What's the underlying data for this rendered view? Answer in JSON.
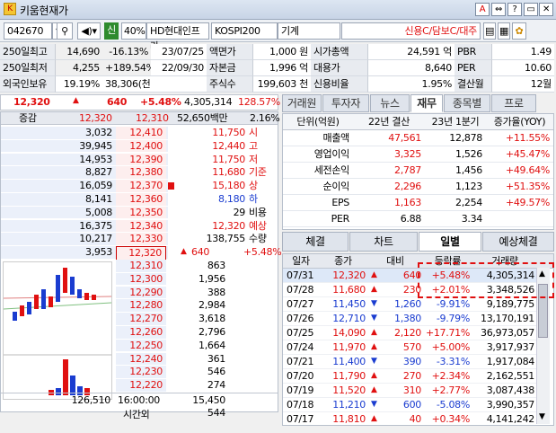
{
  "window": {
    "title": "키움현재가"
  },
  "toolbar": {
    "code": "042670",
    "pct": "40%",
    "name": "HD현대인프라",
    "market": "KOSPI200",
    "sector": "기계",
    "credit": "신용C/담보C/대주",
    "si": "신"
  },
  "info": [
    [
      "250일최고",
      "14,690",
      "-16.13%",
      "23/07/25",
      "액면가",
      "1,000 원",
      "시가총액",
      "24,591 억",
      "PBR",
      "1.49"
    ],
    [
      "250일최저",
      "4,255",
      "+189.54%",
      "22/09/30",
      "자본금",
      "1,996 억",
      "대용가",
      "8,640",
      "PER",
      "10.60"
    ],
    [
      "외국인보유",
      "19.19%",
      "38,306(천)",
      "",
      "주식수",
      "199,603 천",
      "신용비율",
      "1.95%",
      "결산월",
      "12월"
    ]
  ],
  "price": {
    "cur": "12,320",
    "arrow": "▲",
    "diff": "640",
    "rate": "+5.48%",
    "vol": "4,305,314",
    "rate2": "128.57%"
  },
  "orderbook": {
    "label": "증감",
    "top": "12,320",
    "top2": "12,310",
    "amt": "52,650백만",
    "amtpct": "2.16%",
    "asks": [
      [
        "3,032",
        "12,410"
      ],
      [
        "39,945",
        "12,400"
      ],
      [
        "14,953",
        "12,390"
      ],
      [
        "8,827",
        "12,380"
      ],
      [
        "16,059",
        "12,370"
      ],
      [
        "8,141",
        "12,360"
      ],
      [
        "5,008",
        "12,350"
      ],
      [
        "16,375",
        "12,340"
      ],
      [
        "10,217",
        "12,330"
      ],
      [
        "3,953",
        "12,320"
      ]
    ],
    "bids": [
      [
        "12,310",
        "863"
      ],
      [
        "12,300",
        "1,956"
      ],
      [
        "12,290",
        "388"
      ],
      [
        "12,280",
        "2,984"
      ],
      [
        "12,270",
        "3,618"
      ],
      [
        "12,260",
        "2,796"
      ],
      [
        "12,250",
        "1,664"
      ],
      [
        "12,240",
        "361"
      ],
      [
        "12,230",
        "546"
      ],
      [
        "12,220",
        "274"
      ]
    ],
    "side": [
      [
        "11,750",
        "시"
      ],
      [
        "12,440",
        "고"
      ],
      [
        "11,750",
        "저"
      ],
      [
        "11,680",
        "기준"
      ],
      [
        "15,180",
        "상"
      ],
      [
        "8,180",
        "하"
      ],
      [
        "29",
        "비용"
      ],
      [
        "12,320",
        "예상"
      ],
      [
        "138,755",
        "수량"
      ]
    ],
    "exp": {
      "arrow": "▲",
      "diff": "640",
      "rate": "+5.48%"
    },
    "foot": {
      "total": "126,510",
      "time": "16:00:00",
      "tv": "15,450",
      "after": "시간외",
      "av": "544"
    }
  },
  "tabs": [
    "거래원",
    "투자자",
    "뉴스",
    "재무",
    "종목별",
    "프로"
  ],
  "fin": {
    "head": [
      "단위(억원)",
      "22년 결산",
      "23년 1분기",
      "증가율(YOY)"
    ],
    "rows": [
      [
        "매출액",
        "47,561",
        "12,878",
        "+11.55%"
      ],
      [
        "영업이익",
        "3,325",
        "1,526",
        "+45.47%"
      ],
      [
        "세전손익",
        "2,787",
        "1,456",
        "+49.64%"
      ],
      [
        "순이익",
        "2,296",
        "1,123",
        "+51.35%"
      ],
      [
        "EPS",
        "1,163",
        "2,254",
        "+49.57%"
      ],
      [
        "PER",
        "6.88",
        "3.34",
        ""
      ]
    ]
  },
  "tabs2": [
    "체결",
    "차트",
    "일별",
    "예상체결"
  ],
  "daily": {
    "head": [
      "일자",
      "종가",
      "대비",
      "등락률",
      "거래량"
    ],
    "rows": [
      [
        "07/31",
        "12,320",
        "▲",
        "640",
        "+5.48%",
        "4,305,314",
        "r"
      ],
      [
        "07/28",
        "11,680",
        "▲",
        "230",
        "+2.01%",
        "3,348,526",
        "r"
      ],
      [
        "07/27",
        "11,450",
        "▼",
        "1,260",
        "-9.91%",
        "9,189,775",
        "b"
      ],
      [
        "07/26",
        "12,710",
        "▼",
        "1,380",
        "-9.79%",
        "13,170,191",
        "b"
      ],
      [
        "07/25",
        "14,090",
        "▲",
        "2,120",
        "+17.71%",
        "36,973,057",
        "r"
      ],
      [
        "07/24",
        "11,970",
        "▲",
        "570",
        "+5.00%",
        "3,917,937",
        "r"
      ],
      [
        "07/21",
        "11,400",
        "▼",
        "390",
        "-3.31%",
        "1,917,084",
        "b"
      ],
      [
        "07/20",
        "11,790",
        "▲",
        "270",
        "+2.34%",
        "2,162,551",
        "r"
      ],
      [
        "07/19",
        "11,520",
        "▲",
        "310",
        "+2.77%",
        "3,087,438",
        "r"
      ],
      [
        "07/18",
        "11,210",
        "▼",
        "600",
        "-5.08%",
        "3,990,357",
        "b"
      ],
      [
        "07/17",
        "11,810",
        "▲",
        "40",
        "+0.34%",
        "4,141,242",
        "r"
      ]
    ]
  },
  "colors": {
    "up": "#e01010",
    "down": "#1a3cd0"
  }
}
